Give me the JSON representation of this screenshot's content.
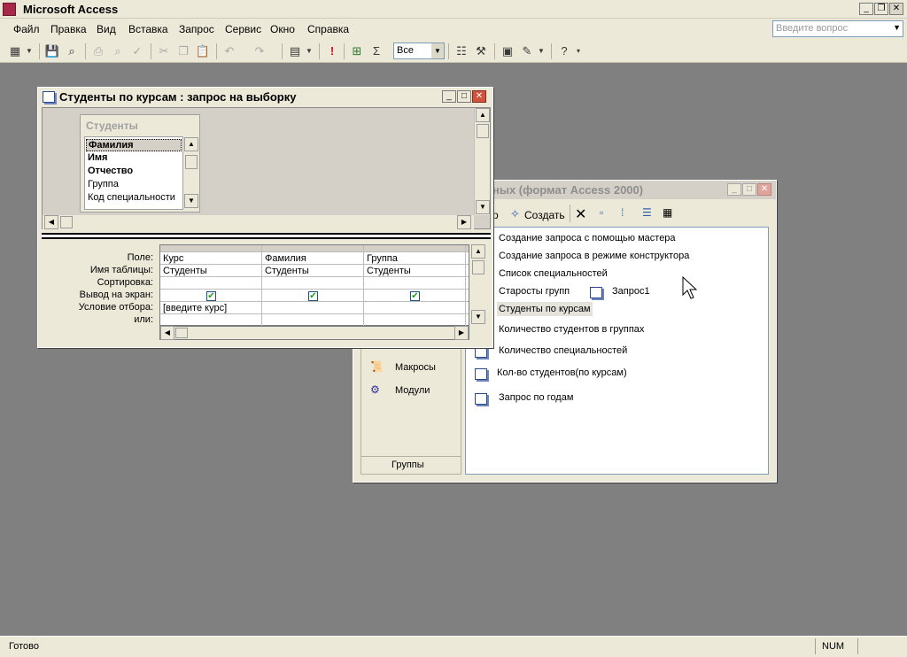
{
  "app": {
    "title": "Microsoft Access",
    "help_placeholder": "Введите вопрос"
  },
  "menu": [
    "Файл",
    "Правка",
    "Вид",
    "Вставка",
    "Запрос",
    "Сервис",
    "Окно",
    "Справка"
  ],
  "toolbar": {
    "combo_value": "Все"
  },
  "status": {
    "text": "Готово",
    "num": "NUM"
  },
  "db_window": {
    "title": "ных (формат Access 2000)",
    "tools": {
      "open_partial": "р",
      "create": "Создать"
    },
    "groups_label": "Группы",
    "nav": [
      "Макросы",
      "Модули"
    ],
    "items": [
      "Создание запроса с помощью мастера",
      "Создание запроса в режиме конструктора",
      "Список специальностей",
      "Старосты групп",
      "Запрос1",
      "Студенты по курсам",
      "Количество студентов в группах",
      "Количество специальностей",
      "Кол-во студентов(по курсам)",
      "Запрос по годам"
    ]
  },
  "query_window": {
    "title": "Студенты по курсам : запрос на выборку",
    "table_name": "Студенты",
    "fields": [
      "Фамилия",
      "Имя",
      "Отчество",
      "Группа",
      "Код специальности"
    ],
    "row_labels": [
      "Поле:",
      "Имя таблицы:",
      "Сортировка:",
      "Вывод на экран:",
      "Условие отбора:",
      "или:"
    ],
    "columns": [
      {
        "field": "Курс",
        "table": "Студенты",
        "criteria": "[введите курс]",
        "show": true
      },
      {
        "field": "Фамилия",
        "table": "Студенты",
        "criteria": "",
        "show": true
      },
      {
        "field": "Группа",
        "table": "Студенты",
        "criteria": "",
        "show": true
      }
    ]
  }
}
